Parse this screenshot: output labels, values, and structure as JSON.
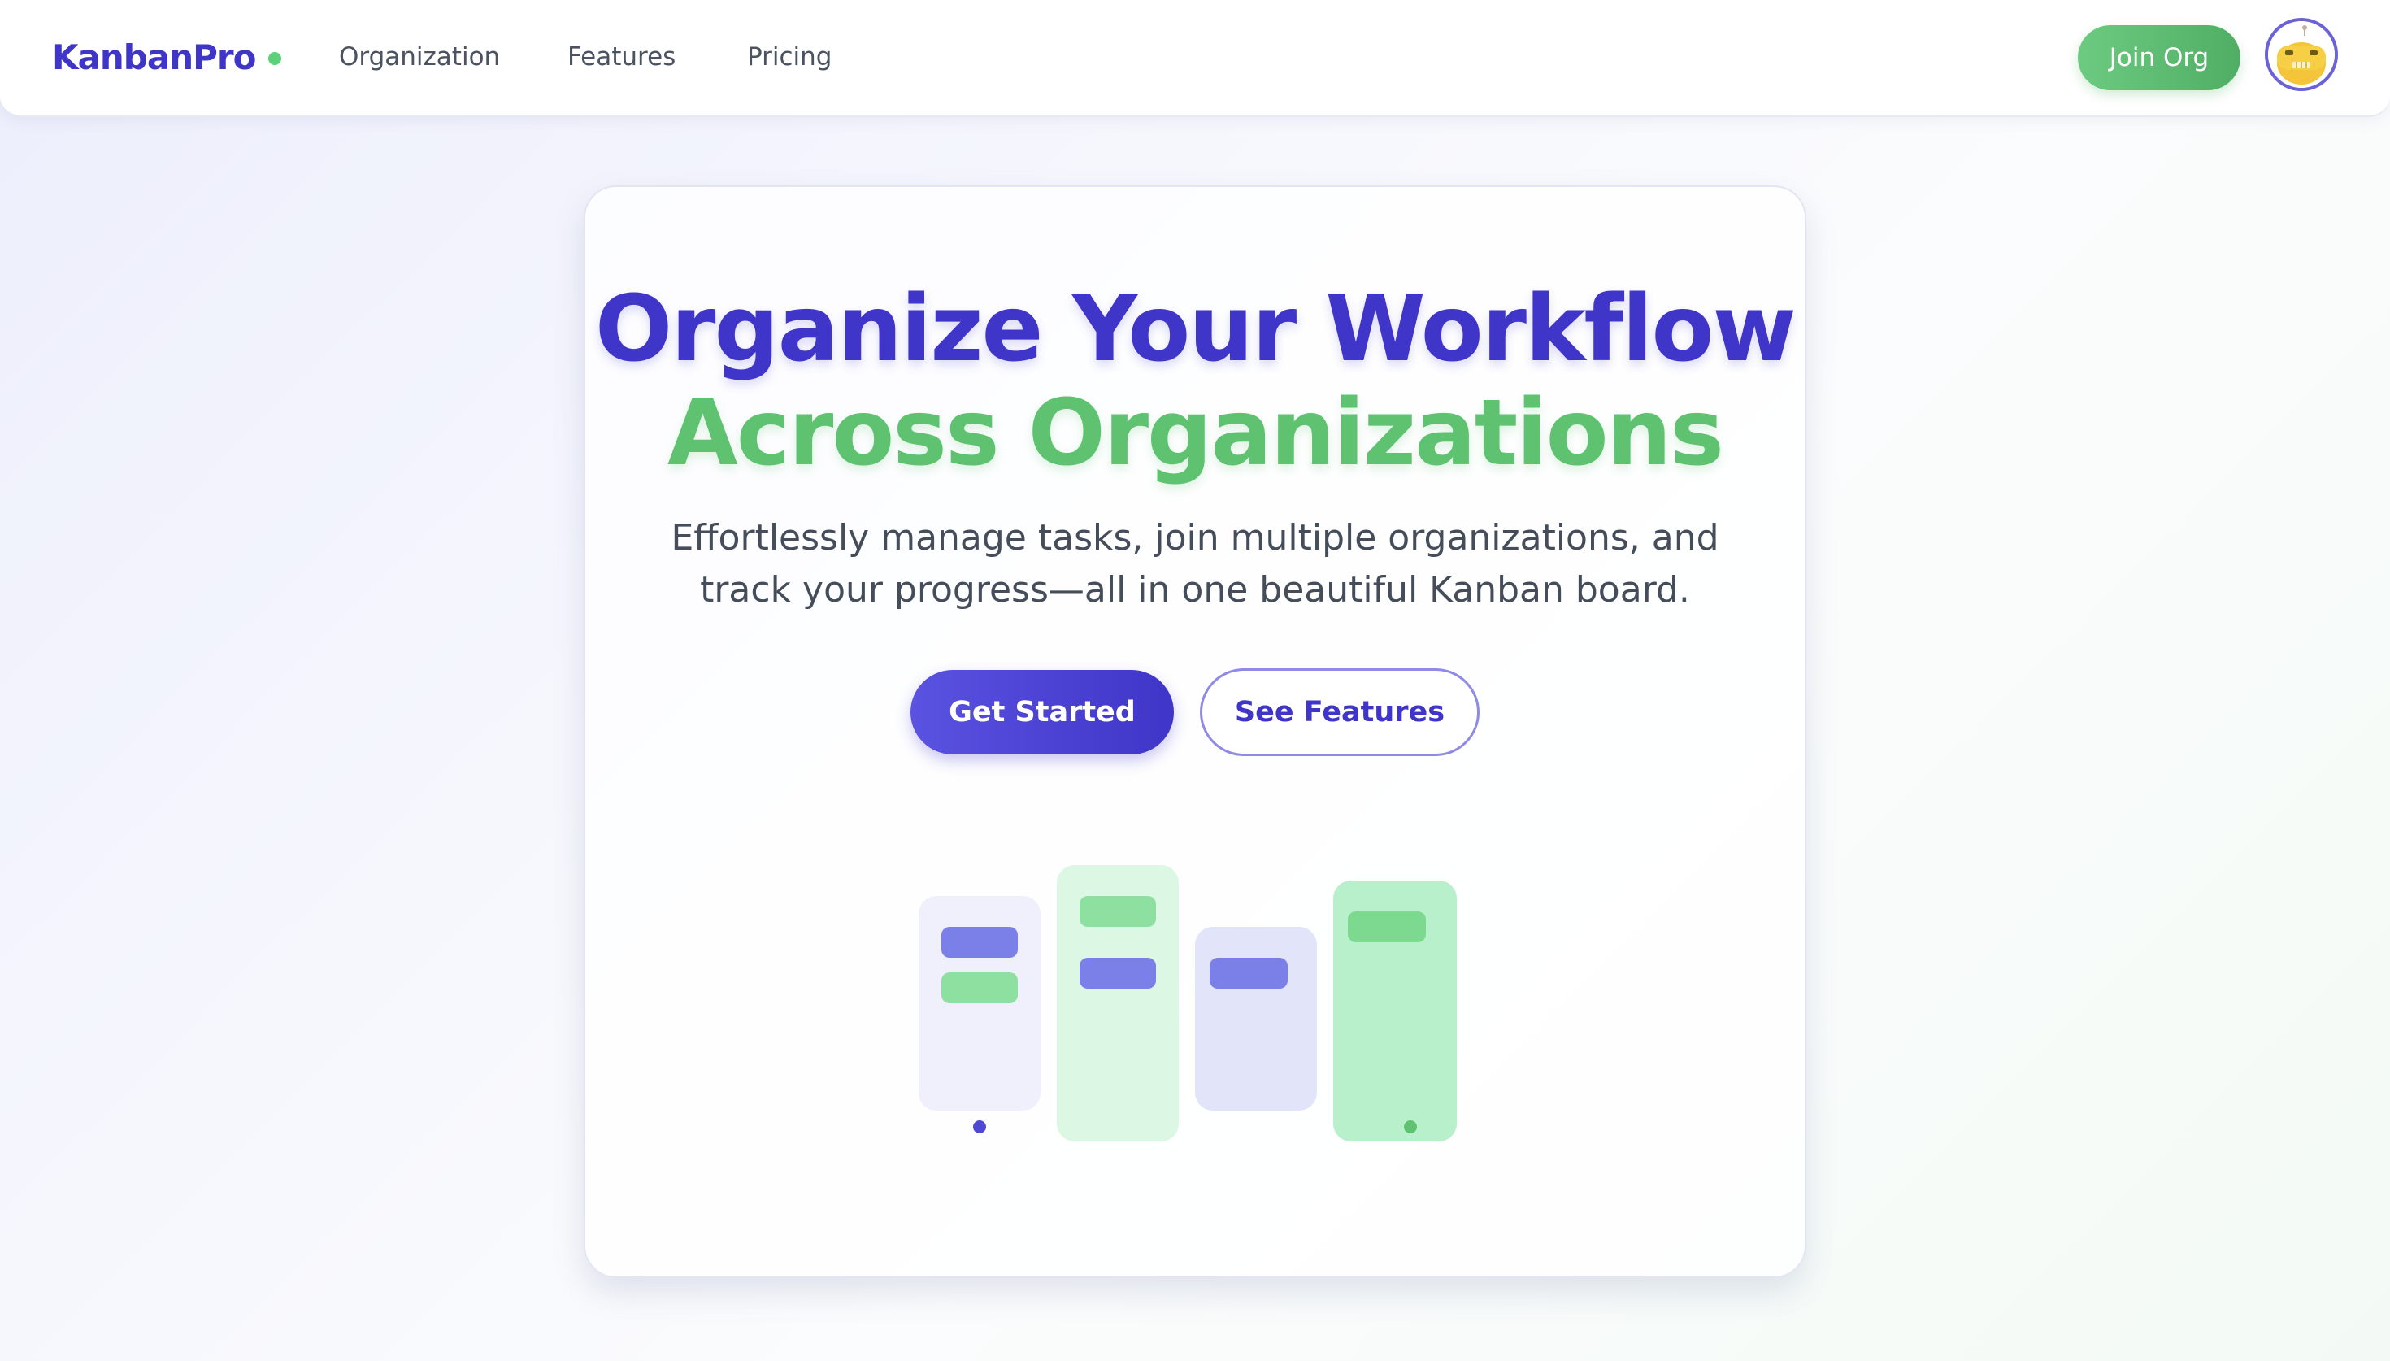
{
  "header": {
    "logo": "KanbanPro",
    "nav": [
      "Organization",
      "Features",
      "Pricing"
    ],
    "join_label": "Join Org"
  },
  "hero": {
    "title_line1": "Organize Your Workflow",
    "title_line2": "Across Organizations",
    "subtitle_line1": "Effortlessly manage tasks, join multiple organizations, and",
    "subtitle_line2": "track your progress—all in one beautiful Kanban board.",
    "primary_cta": "Get Started",
    "secondary_cta": "See Features"
  },
  "colors": {
    "brand_purple": "#3f35c8",
    "brand_green": "#5ec270",
    "chip_purple": "#7b7fe8",
    "chip_green": "#8ee0a0"
  },
  "icons": {
    "logo_status": "status-dot-icon",
    "avatar": "robot-avatar-icon"
  }
}
